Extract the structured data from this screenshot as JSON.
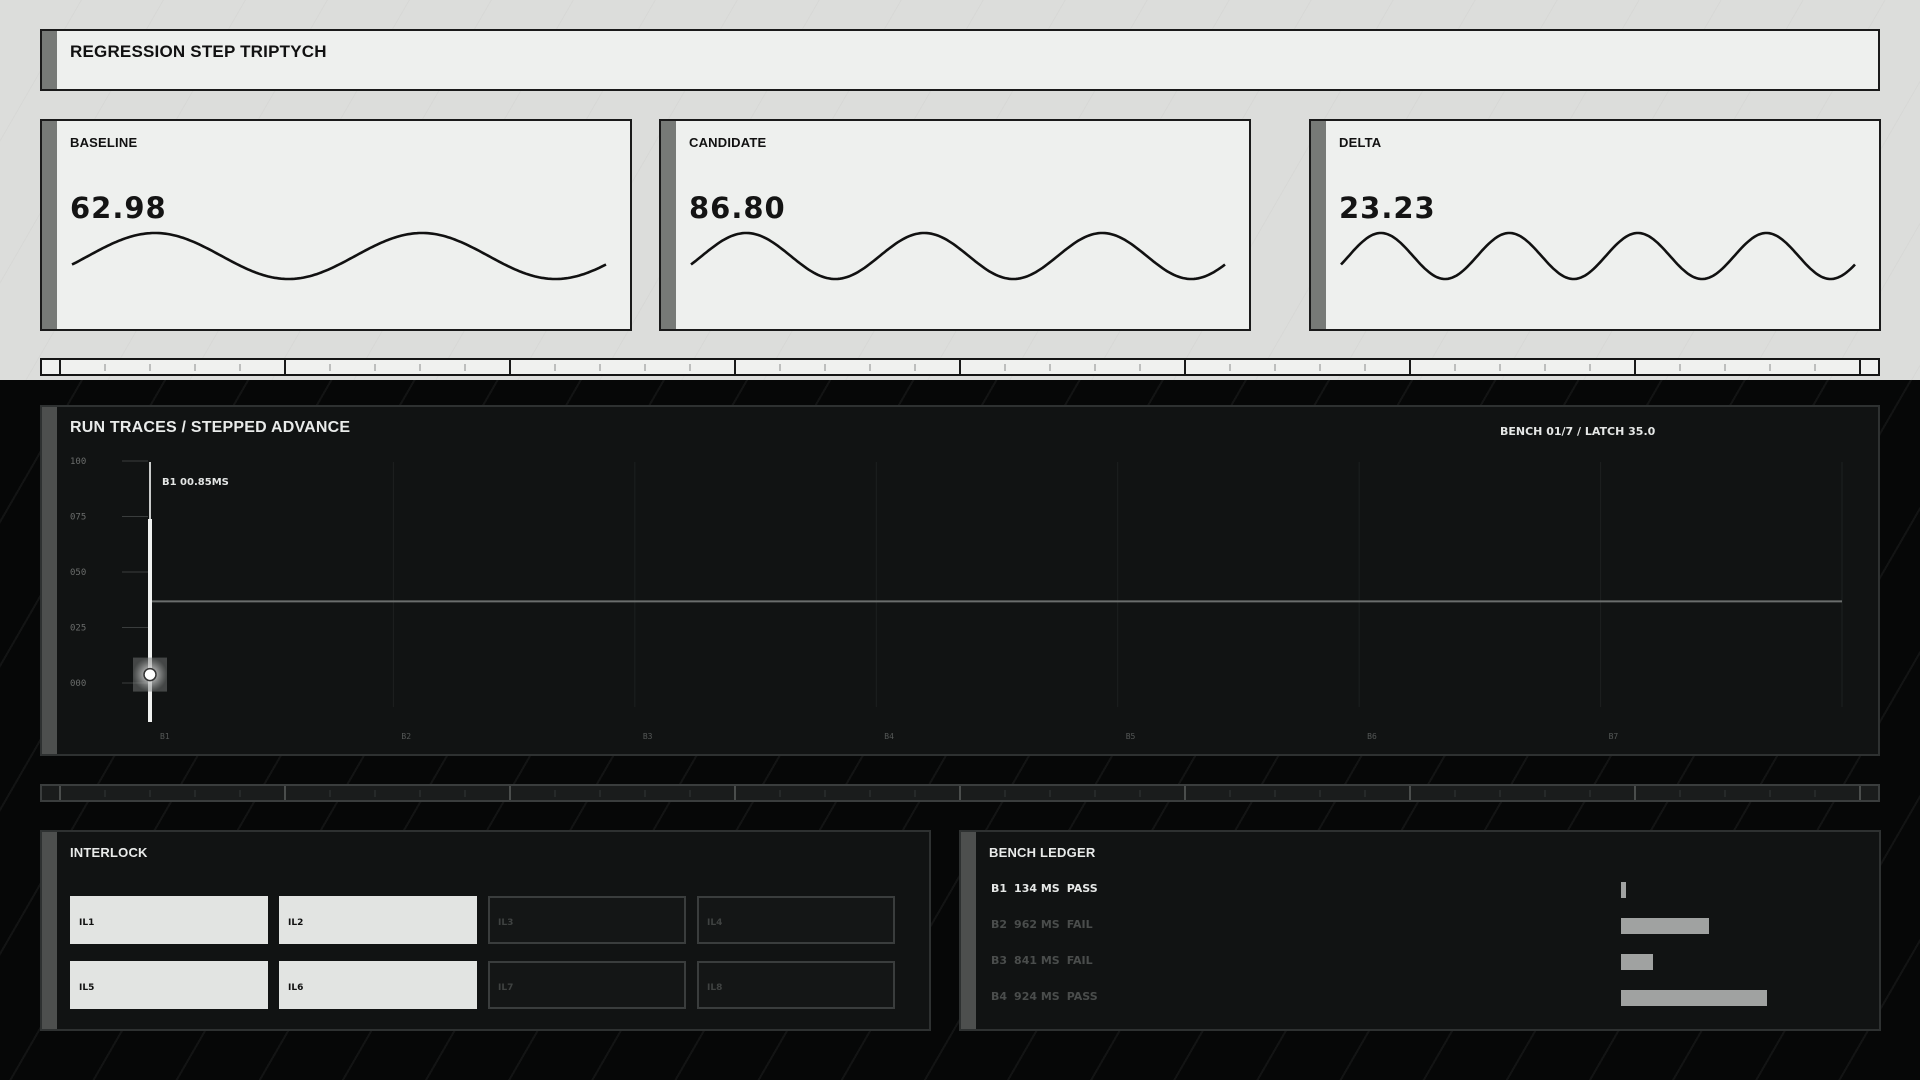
{
  "header": {
    "title": "REGRESSION STEP TRIPTYCH"
  },
  "metrics": [
    {
      "label": "BASELINE",
      "value": "62.98",
      "cycles": 2
    },
    {
      "label": "CANDIDATE",
      "value": "86.80",
      "cycles": 3
    },
    {
      "label": "DELTA",
      "value": "23.23",
      "cycles": 4
    }
  ],
  "run_traces": {
    "title": "RUN TRACES / STEPPED ADVANCE",
    "meta": "BENCH 01/7 / LATCH 35.0",
    "marker_label": "B1 00.85MS",
    "y_ticks": [
      "100",
      "075",
      "050",
      "025",
      "000"
    ],
    "categories": [
      "B1",
      "B2",
      "B3",
      "B4",
      "B5",
      "B6",
      "B7"
    ],
    "trace_level": 44,
    "marker_value": 11
  },
  "interlock": {
    "title": "INTERLOCK",
    "items": [
      {
        "label": "IL1",
        "on": true
      },
      {
        "label": "IL2",
        "on": true
      },
      {
        "label": "IL3",
        "on": false
      },
      {
        "label": "IL4",
        "on": false
      },
      {
        "label": "IL5",
        "on": true
      },
      {
        "label": "IL6",
        "on": true
      },
      {
        "label": "IL7",
        "on": false
      },
      {
        "label": "IL8",
        "on": false
      }
    ]
  },
  "ledger": {
    "title": "BENCH LEDGER",
    "rows": [
      {
        "bench": "B1",
        "ms": "134 MS",
        "status": "PASS",
        "active": true,
        "fraction": 0.03
      },
      {
        "bench": "B2",
        "ms": "962 MS",
        "status": "FAIL",
        "active": false,
        "fraction": 0.49
      },
      {
        "bench": "B3",
        "ms": "841 MS",
        "status": "FAIL",
        "active": false,
        "fraction": 0.18
      },
      {
        "bench": "B4",
        "ms": "924 MS",
        "status": "PASS",
        "active": false,
        "fraction": 0.81
      }
    ]
  }
}
